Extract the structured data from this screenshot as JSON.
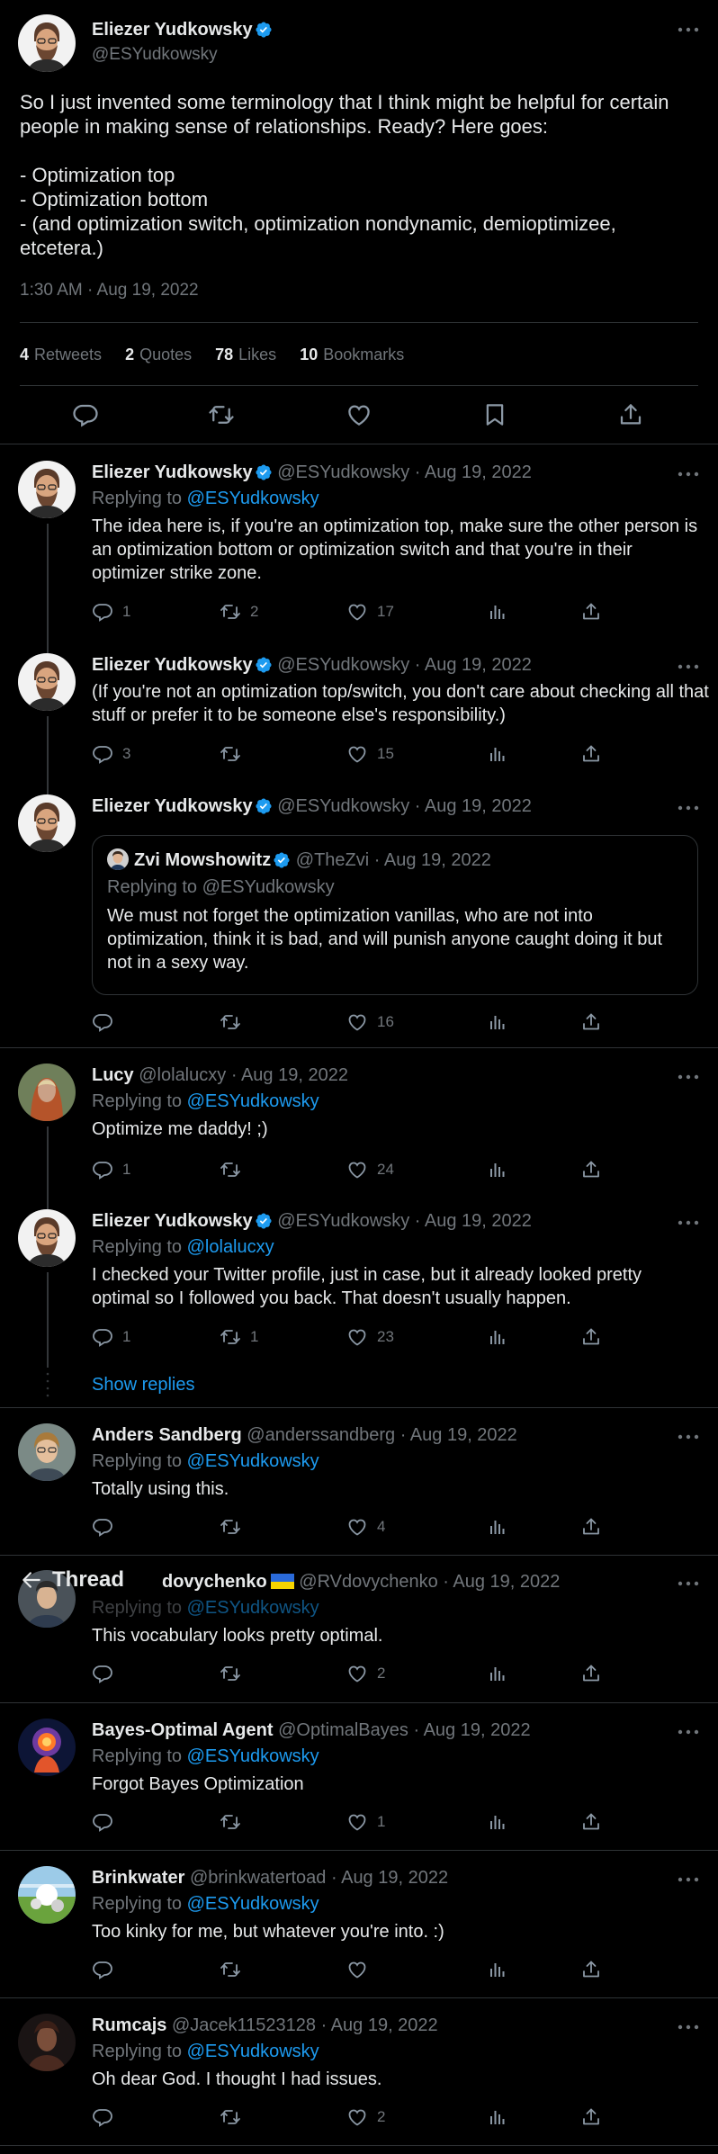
{
  "header": {
    "title": "Thread"
  },
  "main_tweet": {
    "author": "Eliezer Yudkowsky",
    "handle": "@ESYudkowsky",
    "body": "So I just invented some terminology that I think might be helpful for certain people in making sense of relationships.  Ready?  Here goes:\n\n- Optimization top\n- Optimization bottom\n- (and optimization switch, optimization nondynamic, demioptimizee, etcetera.)",
    "timestamp": "1:30 AM · Aug 19, 2022",
    "stats": {
      "retweets": "4",
      "retweets_label": "Retweets",
      "quotes": "2",
      "quotes_label": "Quotes",
      "likes": "78",
      "likes_label": "Likes",
      "bookmarks": "10",
      "bookmarks_label": "Bookmarks"
    }
  },
  "replies": [
    {
      "author": "Eliezer Yudkowsky",
      "handle": "@ESYudkowsky",
      "date": "· Aug 19, 2022",
      "replying_label": "Replying to",
      "replying_to": "@ESYudkowsky",
      "text": "The idea here is, if you're an optimization top, make sure the other person is an optimization bottom or optimization switch and that you're in their optimizer strike zone.",
      "replies": "1",
      "retweets": "2",
      "likes": "17"
    },
    {
      "author": "Eliezer Yudkowsky",
      "handle": "@ESYudkowsky",
      "date": "· Aug 19, 2022",
      "text": "(If you're not an optimization top/switch, you don't care about checking all that stuff or prefer it to be someone else's responsibility.)",
      "replies": "3",
      "retweets": "",
      "likes": "15"
    },
    {
      "author": "Eliezer Yudkowsky",
      "handle": "@ESYudkowsky",
      "date": "· Aug 19, 2022",
      "quote": {
        "author": "Zvi Mowshowitz",
        "handle": "@TheZvi",
        "date": "· Aug 19, 2022",
        "replying": "Replying to @ESYudkowsky",
        "text": "We must not forget the optimization vanillas, who are not into optimization, think it is bad, and will punish anyone caught doing it but not in a sexy way."
      },
      "replies": "",
      "retweets": "",
      "likes": "16"
    },
    {
      "author": "Lucy",
      "handle": "@lolalucxy",
      "date": "· Aug 19, 2022",
      "replying_label": "Replying to",
      "replying_to": "@ESYudkowsky",
      "text": "Optimize me daddy! ;)",
      "replies": "1",
      "retweets": "",
      "likes": "24"
    },
    {
      "author": "Eliezer Yudkowsky",
      "handle": "@ESYudkowsky",
      "date": "· Aug 19, 2022",
      "replying_label": "Replying to",
      "replying_to": "@lolalucxy",
      "text": "I checked your Twitter profile, just in case, but it already looked pretty optimal so I followed you back.  That doesn't usually happen.",
      "replies": "1",
      "retweets": "1",
      "likes": "23"
    },
    {
      "author": "Anders Sandberg",
      "handle": "@anderssandberg",
      "date": "· Aug 19, 2022",
      "replying_label": "Replying to",
      "replying_to": "@ESYudkowsky",
      "text": "Totally using this.",
      "replies": "",
      "retweets": "",
      "likes": "4"
    },
    {
      "author": "dovychenko",
      "handle": "@RVdovychenko",
      "date": "· Aug 19, 2022",
      "replying_label": "Replying to",
      "replying_to": "@ESYudkowsky",
      "text": "This vocabulary looks pretty optimal.",
      "replies": "",
      "retweets": "",
      "likes": "2"
    },
    {
      "author": "Bayes-Optimal Agent",
      "handle": "@OptimalBayes",
      "date": "· Aug 19, 2022",
      "replying_label": "Replying to",
      "replying_to": "@ESYudkowsky",
      "text": "Forgot Bayes Optimization",
      "replies": "",
      "retweets": "",
      "likes": "1"
    },
    {
      "author": "Brinkwater",
      "handle": "@brinkwatertoad",
      "date": "· Aug 19, 2022",
      "replying_label": "Replying to",
      "replying_to": "@ESYudkowsky",
      "text": "Too kinky for me, but whatever you're into. :)",
      "replies": "",
      "retweets": "",
      "likes": ""
    },
    {
      "author": "Rumcajs",
      "handle": "@Jacek11523128",
      "date": "· Aug 19, 2022",
      "replying_label": "Replying to",
      "replying_to": "@ESYudkowsky",
      "text": "Oh dear God. I thought I had issues.",
      "replies": "",
      "retweets": "",
      "likes": "2"
    }
  ],
  "show_replies": "Show replies",
  "colors": {
    "background": "#000000",
    "text": "#e7e9ea",
    "secondary": "#71767b",
    "accent": "#1d9bf0",
    "border": "#2f3336"
  },
  "icons": [
    "verified-badge-icon",
    "more-icon",
    "reply-icon",
    "retweet-icon",
    "like-icon",
    "bookmark-icon",
    "share-icon",
    "views-icon",
    "back-arrow-icon"
  ]
}
